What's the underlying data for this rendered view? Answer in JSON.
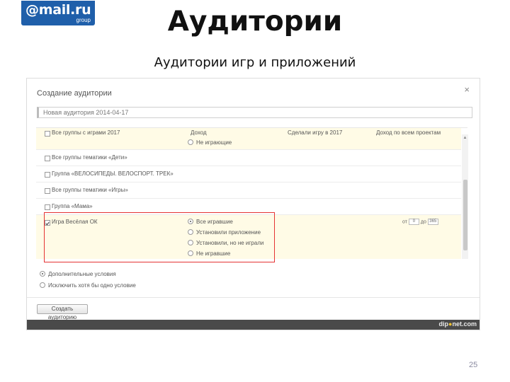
{
  "logo": {
    "brand": "@mail.ru",
    "sub": "group"
  },
  "slide": {
    "title": "Аудитории",
    "subtitle": "Аудитории игр и приложений",
    "page_number": "25"
  },
  "dialog": {
    "title": "Создание аудитории",
    "close_glyph": "×",
    "name_value": "Новая аудитория 2014-04-17",
    "top_row": {
      "label": "Все группы с играми 2017",
      "col2": "Доход",
      "col3": "Сделали игру в 2017",
      "col4": "Доход по всем проектам",
      "radio_label": "Не играющие"
    },
    "rows": [
      {
        "label": "Все группы тематики «Дети»"
      },
      {
        "label": "Группа «ВЕЛОСИПЕДЫ. ВЕЛОСПОРТ. ТРЕК»"
      },
      {
        "label": "Все группы тематики «Игры»"
      },
      {
        "label": "Группа «Мама»"
      }
    ],
    "selected_row": {
      "label": "Игра Весёлая ОК",
      "options": [
        {
          "label": "Все игравшие",
          "selected": true
        },
        {
          "label": "Установили приложение",
          "selected": false
        },
        {
          "label": "Установили, но не играли",
          "selected": false
        },
        {
          "label": "Не игравшие",
          "selected": false
        }
      ],
      "age_from_label": "от",
      "age_from": "0",
      "age_to_label": "до",
      "age_to": "365"
    },
    "conditions": [
      {
        "label": "Дополнительные условия",
        "selected": true
      },
      {
        "label": "Исключить хотя бы одно условие",
        "selected": false
      }
    ],
    "create_button": "Создать аудиторию",
    "watermark": {
      "prefix": "dip",
      "dot": "●",
      "suffix": "net.com"
    }
  },
  "icons": {
    "close": "close-icon",
    "scroll_up": "chevron-up-icon"
  },
  "colors": {
    "accent": "#1f5faa",
    "highlight": "#e53333",
    "row_bg": "#fffbe6"
  }
}
